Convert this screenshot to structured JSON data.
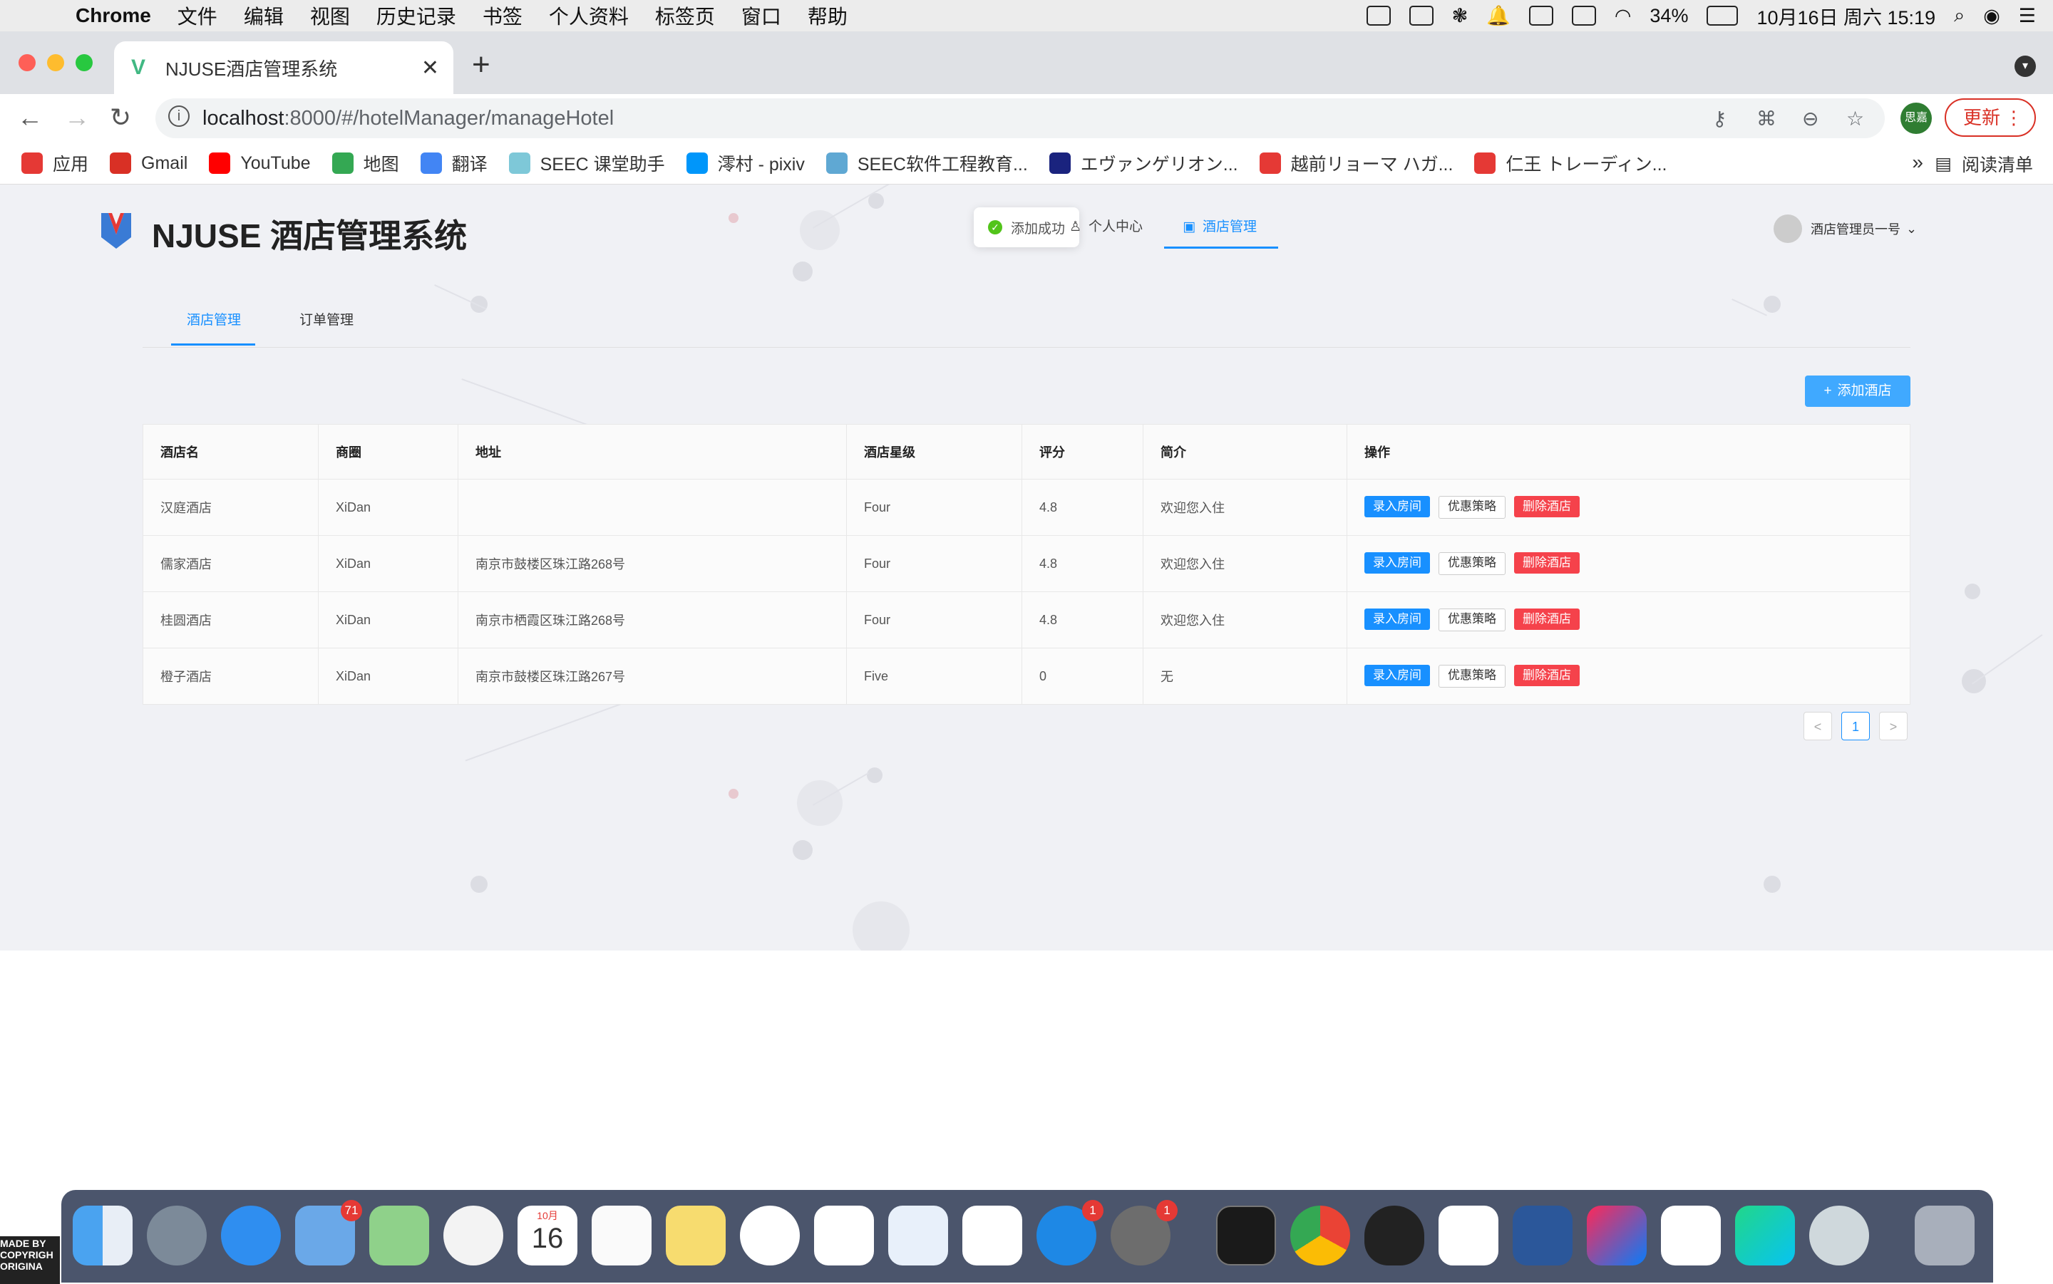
{
  "menubar": {
    "app": "Chrome",
    "items": [
      "文件",
      "编辑",
      "视图",
      "历史记录",
      "书签",
      "个人资料",
      "标签页",
      "窗口",
      "帮助"
    ],
    "battery": "34%",
    "datetime": "10月16日 周六  15:19"
  },
  "browser": {
    "tab_title": "NJUSE酒店管理系统",
    "url_host": "localhost",
    "url_rest": ":8000/#/hotelManager/manageHotel",
    "profile_label": "思嘉",
    "update_label": "更新"
  },
  "bookmarks": [
    {
      "label": "应用",
      "color": "#e53935"
    },
    {
      "label": "Gmail",
      "color": "#d93025"
    },
    {
      "label": "YouTube",
      "color": "#ff0000"
    },
    {
      "label": "地图",
      "color": "#34a853"
    },
    {
      "label": "翻译",
      "color": "#4285f4"
    },
    {
      "label": "SEEC 课堂助手",
      "color": "#7ec8d8"
    },
    {
      "label": "澪村 - pixiv",
      "color": "#0096fa"
    },
    {
      "label": "SEEC软件工程教育...",
      "color": "#5fa8d3"
    },
    {
      "label": "エヴァンゲリオン...",
      "color": "#1a237e"
    },
    {
      "label": "越前リョーマ ハガ...",
      "color": "#e53935"
    },
    {
      "label": "仁王 トレーディン...",
      "color": "#e53935"
    }
  ],
  "bookmarks_more": "»",
  "reading_list": "阅读清单",
  "app": {
    "site_title": "NJUSE 酒店管理系统",
    "toast": "添加成功",
    "nav": [
      "个人中心",
      "酒店管理"
    ],
    "user": "酒店管理员一号",
    "subtabs": [
      "酒店管理",
      "订单管理"
    ],
    "add_button": "添加酒店",
    "table": {
      "headers": [
        "酒店名",
        "商圈",
        "地址",
        "酒店星级",
        "评分",
        "简介",
        "操作"
      ],
      "rows": [
        [
          "汉庭酒店",
          "XiDan",
          "",
          "Four",
          "4.8",
          "欢迎您入住"
        ],
        [
          "儒家酒店",
          "XiDan",
          "南京市鼓楼区珠江路268号",
          "Four",
          "4.8",
          "欢迎您入住"
        ],
        [
          "桂圆酒店",
          "XiDan",
          "南京市栖霞区珠江路268号",
          "Four",
          "4.8",
          "欢迎您入住"
        ],
        [
          "橙子酒店",
          "XiDan",
          "南京市鼓楼区珠江路267号",
          "Five",
          "0",
          "无"
        ]
      ],
      "actions": [
        "录入房间",
        "优惠策略",
        "删除酒店"
      ]
    },
    "pagination": {
      "prev": "<",
      "page": "1",
      "next": ">"
    }
  },
  "dock": {
    "badges": {
      "mail": "71",
      "appstore": "1",
      "settings": "1"
    },
    "calendar_month": "10月",
    "calendar_day": "16"
  },
  "colors": {
    "primary": "#1890ff",
    "danger": "#f5222d",
    "page_bg": "#f0f1f5"
  }
}
